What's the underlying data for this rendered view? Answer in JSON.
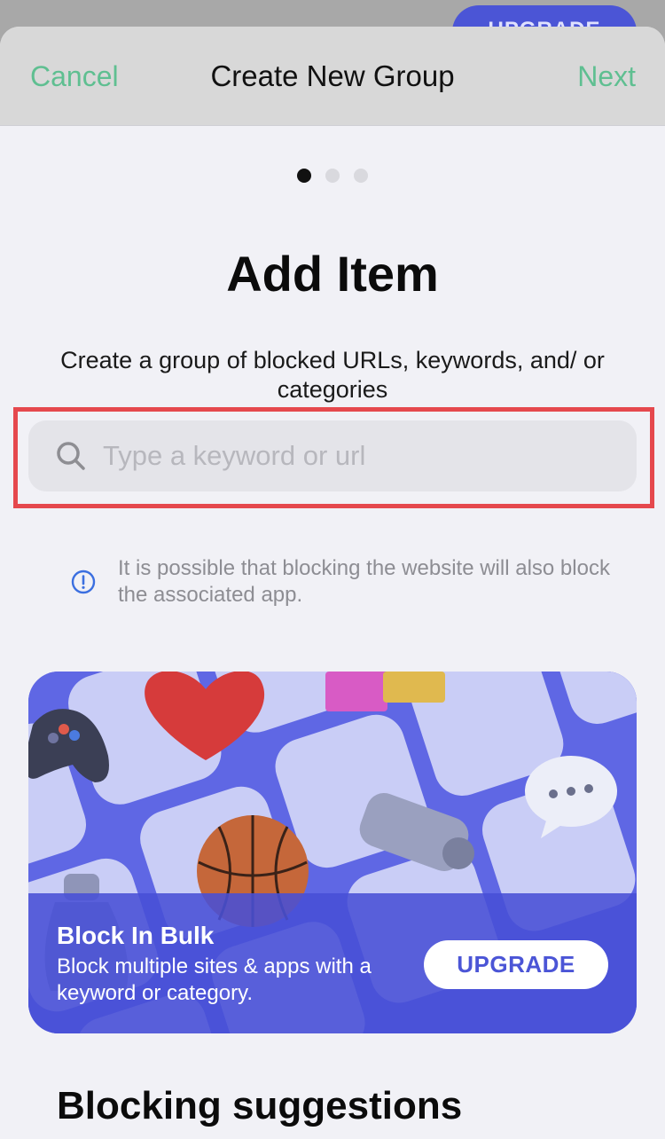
{
  "background_app": {
    "upgrade_label": "UPGRADE"
  },
  "navbar": {
    "cancel_label": "Cancel",
    "title": "Create New Group",
    "next_label": "Next"
  },
  "pager": {
    "count": 3,
    "active_index": 0
  },
  "main": {
    "heading": "Add Item",
    "subtitle": "Create a group of blocked URLs, keywords, and/ or categories",
    "search": {
      "placeholder": "Type a keyword or url",
      "value": ""
    },
    "info_text": "It is possible that blocking the website will also block the associated app."
  },
  "banner": {
    "title": "Block In Bulk",
    "description": "Block multiple sites & apps with a keyword or category.",
    "button_label": "UPGRADE",
    "icons": [
      "game-controller-icon",
      "heart-icon",
      "gift-icon",
      "chat-bubble-icon",
      "basketball-icon",
      "money-roll-icon",
      "money-bag-icon"
    ]
  },
  "suggestions": {
    "title": "Blocking suggestions"
  },
  "colors": {
    "accent_green": "#5fbf91",
    "brand_blue": "#4b55d6",
    "highlight_red": "#e5484d"
  }
}
